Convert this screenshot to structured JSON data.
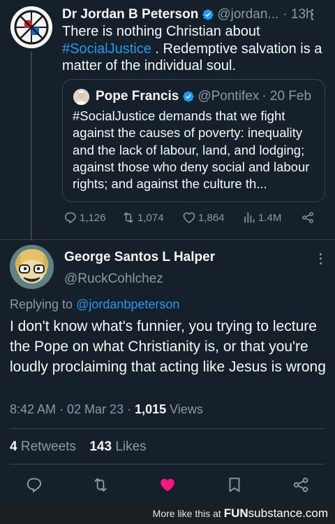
{
  "tweet": {
    "author_name": "Dr Jordan B Peterson",
    "author_handle": "@jordan...",
    "age": "· 13h",
    "text_pre": "There is nothing Christian about ",
    "hashtag": "#SocialJustice",
    "text_post": " . Redemptive salvation is a matter of the individual soul.",
    "quote": {
      "author_name": "Pope Francis",
      "author_handle": "@Pontifex",
      "date": "· 20 Feb",
      "text": "#SocialJustice demands that we fight against the causes of poverty: inequality and the lack of labour, land, and lodging; against those who deny social and labour rights; and against the culture th..."
    },
    "stats": {
      "replies": "1,126",
      "retweets": "1,074",
      "likes": "1,864",
      "views": "1.4M"
    }
  },
  "reply": {
    "author_name": "George Santos L Halper",
    "author_handle": "@RuckCohlchez",
    "replying_prefix": "Replying to ",
    "replying_handle": "@jordanbpeterson",
    "text": "I don't know what's funnier, you trying to lecture the Pope on what Christianity is, or that you're loudly proclaiming that acting like Jesus is wrong",
    "time": "8:42 AM · 02 Mar 23 · ",
    "views_count": "1,015",
    "views_label": " Views",
    "retweets_count": "4",
    "retweets_label": " Retweets",
    "likes_count": "143",
    "likes_label": " Likes",
    "liked": true
  },
  "footer": {
    "text": "More like this at",
    "brand_bold": "FUN",
    "brand_rest": "substance.com"
  },
  "colors": {
    "background": "#15202b",
    "accent": "#1d9bf0",
    "like": "#f91880",
    "muted": "#8b98a5"
  },
  "icons": [
    "more-icon",
    "verified-icon",
    "reply-icon",
    "retweet-icon",
    "like-icon",
    "views-icon",
    "share-icon",
    "bookmark-icon"
  ]
}
